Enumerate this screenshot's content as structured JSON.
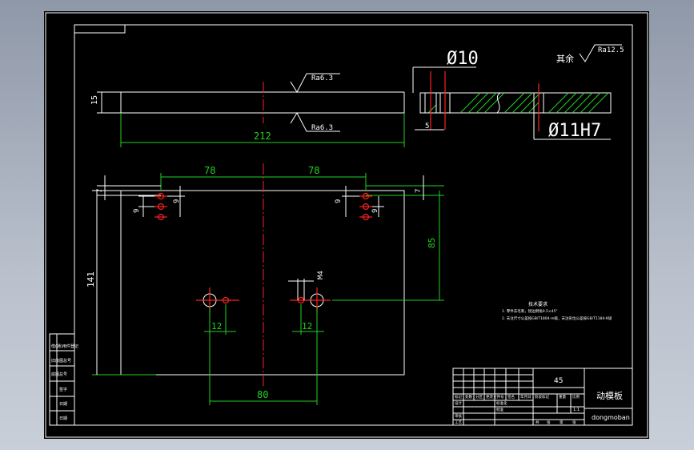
{
  "top_view": {
    "roughness_top": "Ra6.3",
    "roughness_bottom": "Ra6.3",
    "thickness": "15",
    "length": "212"
  },
  "section_view": {
    "hole_dia": "Ø10",
    "hole_fit": "Ø11H7",
    "depth": "5"
  },
  "general_roughness": {
    "label": "其余",
    "value": "Ra12.5"
  },
  "front_view": {
    "dim_left_78": "78",
    "dim_right_78": "78",
    "dim_7_left": "7",
    "dim_7_right": "7",
    "dim_9_a": "9",
    "dim_9_b": "9",
    "dim_9_c": "9",
    "dim_9_d": "9",
    "height": "141",
    "dim_85": "85",
    "dim_m4": "M4",
    "dim_12_left": "12",
    "dim_12_right": "12",
    "dim_80": "80"
  },
  "notes": {
    "title": "技术要求",
    "line1": "1. 零件去毛刺，锐边倒角0.5×45°",
    "line2": "2. 未注尺寸公差按GB/T1804-m级，未注形位公差按GB/T1184-K级"
  },
  "title_block": {
    "material": "45",
    "part_name": "动模板",
    "drawing_no": "dongmoban",
    "scale": "1:1",
    "left_cells": [
      "借(通)用件登记",
      "旧底图总号",
      "底图总号",
      "签字",
      "日期",
      "日期"
    ],
    "header_cells": [
      "标记",
      "处数",
      "分区",
      "更改文件号",
      "签名",
      "年月日"
    ],
    "role_cells": [
      "设计",
      "审核",
      "工艺",
      "标准化",
      "批准"
    ],
    "stage_cells": [
      "阶段标记",
      "重量",
      "比例"
    ],
    "sheet_cells": [
      "共",
      "张",
      "第",
      "张"
    ]
  }
}
